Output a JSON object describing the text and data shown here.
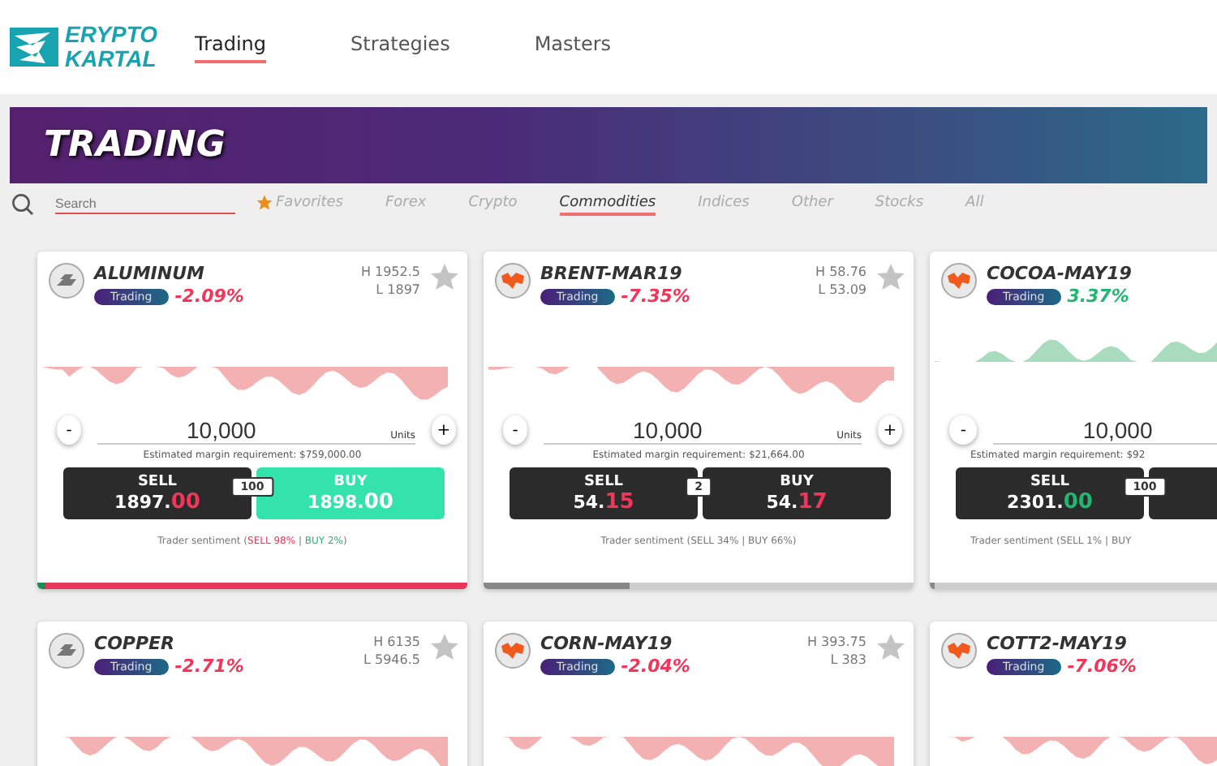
{
  "logo": {
    "line1": "ERYPTO",
    "line2": "KARTAL"
  },
  "nav": [
    {
      "label": "Trading",
      "selected": true
    },
    {
      "label": "Strategies",
      "selected": false
    },
    {
      "label": "Masters",
      "selected": false
    }
  ],
  "banner": {
    "title": "TRADING"
  },
  "search": {
    "placeholder": "Search"
  },
  "filters": [
    {
      "label": "Favorites",
      "selected": false,
      "kind": "star"
    },
    {
      "label": "Forex",
      "selected": false,
      "kind": "plain"
    },
    {
      "label": "Crypto",
      "selected": false,
      "kind": "plain"
    },
    {
      "label": "Commodities",
      "selected": true,
      "kind": "plain"
    },
    {
      "label": "Indices",
      "selected": false,
      "kind": "plain"
    },
    {
      "label": "Other",
      "selected": false,
      "kind": "plain"
    },
    {
      "label": "Stocks",
      "selected": false,
      "kind": "plain"
    },
    {
      "label": "All",
      "selected": false,
      "kind": "plain"
    }
  ],
  "cards": [
    {
      "name": "ALUMINUM",
      "kind": "bars",
      "status": "Trading",
      "change": "-2.09%",
      "color": "#f0365a",
      "high": "H 1952.5",
      "low": "L 1897",
      "minus": "-",
      "units_value": "10,000",
      "units": "Units",
      "plus": "+",
      "margin": "Estimated margin requirement: $759,000.00",
      "sell": {
        "label": "SELL",
        "whole": "1897.",
        "frac": "00",
        "color": "#f0365a"
      },
      "spread": "100",
      "buy": {
        "label": "BUY",
        "whole": "1898.",
        "frac": "00",
        "color": "#ffffff",
        "active": true
      },
      "sentiment": {
        "label": "Trader sentiment (",
        "sell": "SELL 98%",
        "separator": "|",
        "buy": "BUY 2%",
        "close": ")",
        "highlighted": true,
        "level": 0.98
      }
    },
    {
      "name": "BRENT-MAR19",
      "kind": "map",
      "status": "Trading",
      "change": "-7.35%",
      "color": "#f0365a",
      "high": "H 58.76",
      "low": "L 53.09",
      "minus": "-",
      "units_value": "10,000",
      "units": "Units",
      "plus": "+",
      "margin": "Estimated margin requirement: $21,664.00",
      "sell": {
        "label": "SELL",
        "whole": "54.",
        "frac": "15",
        "color": "#f0365a"
      },
      "spread": "2",
      "buy": {
        "label": "BUY",
        "whole": "54.",
        "frac": "17",
        "color": "#f0365a",
        "active": false
      },
      "sentiment": {
        "label": "Trader sentiment (",
        "sell": "SELL 34%",
        "separator": "|",
        "buy": "BUY 66%",
        "close": ")",
        "highlighted": false,
        "level": 0.34
      }
    },
    {
      "name": "COCOA-MAY19",
      "kind": "map",
      "status": "Trading",
      "change": "3.37%",
      "color": "#22b574",
      "minus": "-",
      "units_value": "10,000",
      "margin": "Estimated margin requirement: $92",
      "sell": {
        "label": "SELL",
        "whole": "2301.",
        "frac": "00",
        "color": "#22b574"
      },
      "spread": "100",
      "buy": {
        "active": false
      },
      "sentiment": {
        "label": "Trader sentiment (",
        "sell": "SELL 1%",
        "separator": "|",
        "buy": "BUY",
        "highlighted": false,
        "level": 0.01
      }
    },
    {
      "name": "COPPER",
      "kind": "bars",
      "status": "Trading",
      "change": "-2.71%",
      "color": "#f0365a",
      "high": "H 6135",
      "low": "L 5946.5"
    },
    {
      "name": "CORN-MAY19",
      "kind": "map",
      "status": "Trading",
      "change": "-2.04%",
      "color": "#f0365a",
      "high": "H 393.75",
      "low": "L 383"
    },
    {
      "name": "COTT2-MAY19",
      "kind": "map",
      "status": "Trading",
      "change": "-7.06%",
      "color": "#f0365a"
    }
  ]
}
